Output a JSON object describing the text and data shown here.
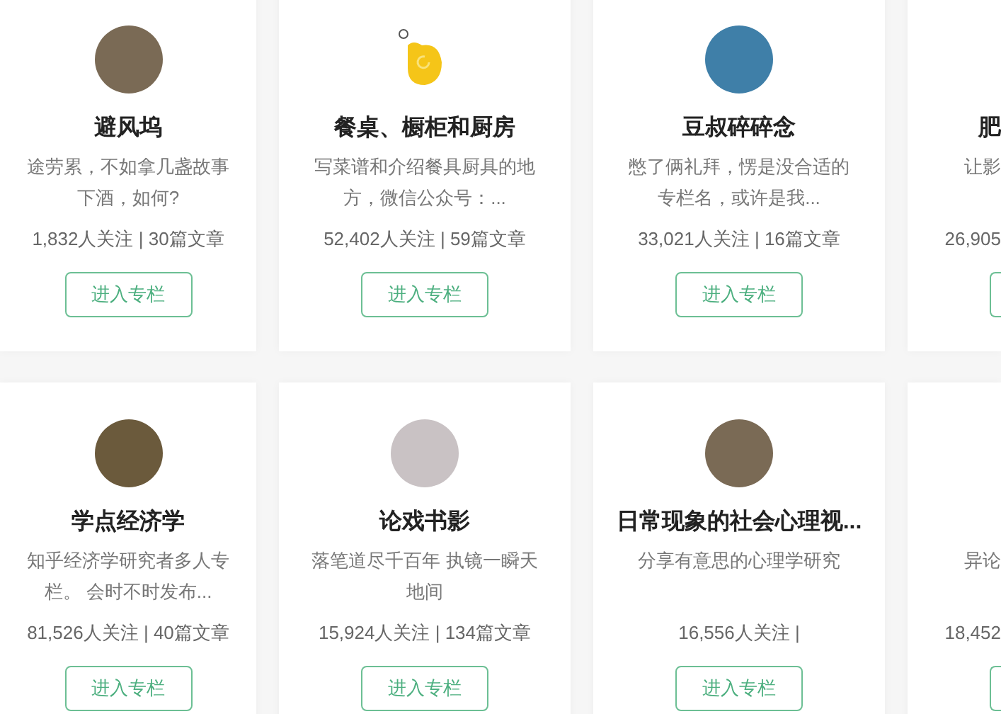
{
  "rows": [
    {
      "cards": [
        {
          "kind": "left-cut",
          "avatar": {
            "kind": "photo"
          },
          "title": "避风坞",
          "description_lines": [
            "途劳累，不如拿几盏故事",
            "下酒，如何?"
          ],
          "stats": "1,832人关注 | 30篇文章",
          "button": "进入专栏"
        },
        {
          "kind": "full",
          "avatar": {
            "kind": "logo"
          },
          "title": "餐桌、橱柜和厨房",
          "description_lines": [
            "写菜谱和介绍餐具厨具的地",
            "方，微信公众号：..."
          ],
          "stats": "52,402人关注 | 59篇文章",
          "button": "进入专栏"
        },
        {
          "kind": "full",
          "avatar": {
            "kind": "photo"
          },
          "title": "豆叔碎碎念",
          "description_lines": [
            "憋了俩礼拜，愣是没合适的",
            "专栏名，或许是我..."
          ],
          "stats": "33,021人关注 | 16篇文章",
          "button": "进入专栏"
        },
        {
          "kind": "right-cut",
          "title": "肥",
          "description_lines": [
            "让影"
          ],
          "stats": "26,905"
        }
      ]
    },
    {
      "cards": [
        {
          "kind": "left-cut",
          "avatar": {
            "kind": "photo"
          },
          "title": "学点经济学",
          "description_lines": [
            "知乎经济学研究者多人专",
            "栏。 会时不时发布..."
          ],
          "stats": "81,526人关注 | 40篇文章",
          "button": "进入专栏"
        },
        {
          "kind": "full",
          "avatar": {
            "kind": "photo"
          },
          "title": "论戏书影",
          "description_lines": [
            "落笔道尽千百年 执镜一瞬天",
            "地间"
          ],
          "stats": "15,924人关注 | 134篇文章",
          "button": "进入专栏"
        },
        {
          "kind": "full",
          "avatar": {
            "kind": "photo"
          },
          "title": "日常现象的社会心理视...",
          "description_lines": [
            "分享有意思的心理学研究"
          ],
          "stats": "16,556人关注 |",
          "button": "进入专栏"
        },
        {
          "kind": "right-cut",
          "description_lines": [
            "异论"
          ],
          "stats": "18,452"
        }
      ]
    }
  ]
}
